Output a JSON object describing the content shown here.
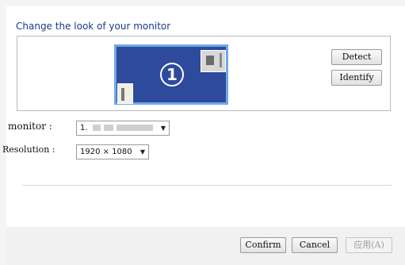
{
  "heading": "Change the look of your monitor",
  "preview": {
    "monitor_number": "1"
  },
  "buttons": {
    "detect": "Detect",
    "identify": "Identify",
    "confirm": "Confirm",
    "cancel": "Cancel",
    "apply": "应用(A)"
  },
  "fields": {
    "monitor": {
      "label": "monitor :",
      "value": "1."
    },
    "resolution": {
      "label": "Resolution :",
      "value": "1920 × 1080"
    }
  },
  "colors": {
    "heading": "#1e3a8a",
    "monitor_tile": "#2e4a9c",
    "monitor_tile_border": "#6ea8e8"
  },
  "icons": {
    "dropdown": "chevron-down-icon",
    "window_preview": "window-thumbnail-icon",
    "document_preview": "document-thumbnail-icon"
  }
}
